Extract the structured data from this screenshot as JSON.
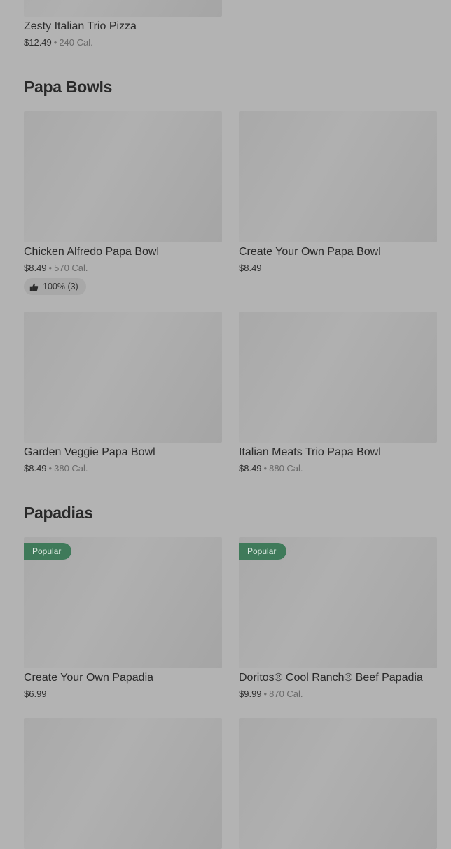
{
  "sections": [
    {
      "title": "",
      "items": [
        {
          "name": "Zesty Italian Trio Pizza",
          "price": "$12.49",
          "calories": "240 Cal."
        }
      ]
    },
    {
      "title": "Papa Bowls",
      "items": [
        {
          "name": "Chicken Alfredo Papa Bowl",
          "price": "$8.49",
          "calories": "570 Cal.",
          "rating": "100% (3)"
        },
        {
          "name": "Create Your Own Papa Bowl",
          "price": "$8.49",
          "calories": ""
        },
        {
          "name": "Garden Veggie Papa Bowl",
          "price": "$8.49",
          "calories": "380 Cal."
        },
        {
          "name": "Italian Meats Trio Papa Bowl",
          "price": "$8.49",
          "calories": "880 Cal."
        }
      ]
    },
    {
      "title": "Papadias",
      "items": [
        {
          "name": "Create Your Own Papadia",
          "price": "$6.99",
          "calories": "",
          "badge": "Popular"
        },
        {
          "name": "Doritos® Cool Ranch® Beef Papadia",
          "price": "$9.99",
          "calories": "870 Cal.",
          "badge": "Popular"
        }
      ]
    }
  ],
  "separator": "•",
  "icons": {
    "rating": "thumbs-up-icon"
  },
  "colors": {
    "overlay_background": "#b3b3b3",
    "popular_badge": "#3f7a5a"
  }
}
